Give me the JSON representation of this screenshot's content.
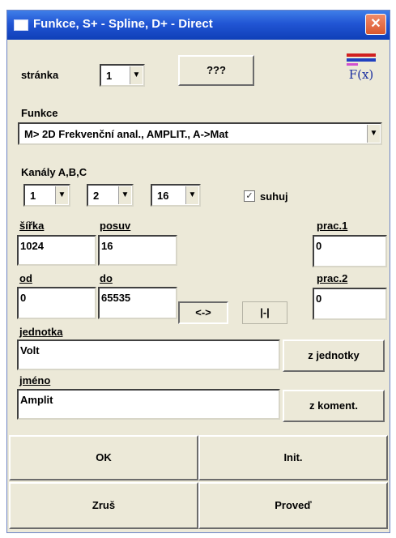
{
  "window": {
    "title": "Funkce, S+ - Spline, D+ - Direct"
  },
  "stranka": {
    "label": "stránka",
    "value": "1",
    "help_button": "???"
  },
  "logo": {
    "text": "F(x)"
  },
  "funkce": {
    "label": "Funkce",
    "value": "M> 2D Frekvenční anal., AMPLIT., A->Mat"
  },
  "kanaly": {
    "label": "Kanály A,B,C",
    "a": "1",
    "b": "2",
    "c": "16",
    "checkbox_label": "suhuj",
    "checked": true
  },
  "sirka": {
    "label": "šířka",
    "value": "1024"
  },
  "posuv": {
    "label": "posuv",
    "value": "16"
  },
  "prac1": {
    "label": "prac.1",
    "value": "0"
  },
  "od": {
    "label": "od",
    "value": "0"
  },
  "do": {
    "label": "do",
    "value": "65535"
  },
  "range_buttons": {
    "swap": "<->",
    "full": "|-|"
  },
  "prac2": {
    "label": "prac.2",
    "value": "0"
  },
  "jednotka": {
    "label": "jednotka",
    "value": "Volt",
    "button": "z jednotky"
  },
  "jmeno": {
    "label": "jméno",
    "value": "Amplit",
    "button": "z koment."
  },
  "buttons": {
    "ok": "OK",
    "init": "Init.",
    "cancel": "Zruš",
    "run": "Proveď"
  },
  "colors": {
    "title_bar": "#2155d4",
    "dialog_bg": "#ece9d8",
    "close_button": "#d9582f"
  }
}
